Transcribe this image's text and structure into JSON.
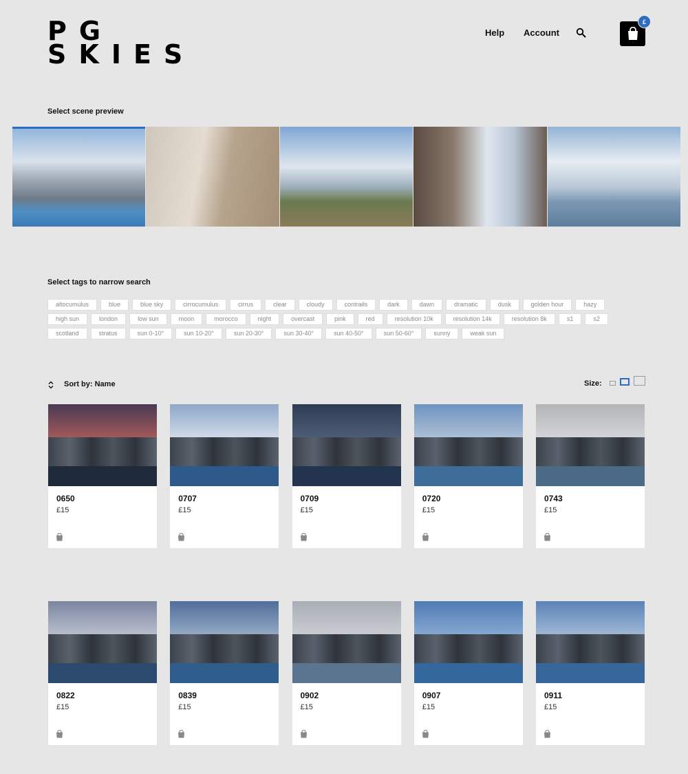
{
  "header": {
    "logo_line1": "PG",
    "logo_line2": "SKIES",
    "nav_help": "Help",
    "nav_account": "Account",
    "cart_badge": "£"
  },
  "scene_preview": {
    "label": "Select scene preview",
    "scenes": [
      "pool house",
      "interior room",
      "forest road",
      "city street",
      "ocean island"
    ]
  },
  "tags_section": {
    "label": "Select tags to narrow search",
    "tags": [
      "altocumulus",
      "blue",
      "blue sky",
      "cirrocumulus",
      "cirrus",
      "clear",
      "cloudy",
      "contrails",
      "dark",
      "dawn",
      "dramatic",
      "dusk",
      "golden hour",
      "hazy",
      "high sun",
      "london",
      "low sun",
      "moon",
      "morocco",
      "night",
      "overcast",
      "pink",
      "red",
      "resolution 10k",
      "resolution 14k",
      "resolution 8k",
      "s1",
      "s2",
      "scotland",
      "stratus",
      "sun 0-10°",
      "sun 10-20°",
      "sun 20-30°",
      "sun 30-40°",
      "sun 40-50°",
      "sun 50-60°",
      "sunny",
      "weak sun"
    ]
  },
  "sort": {
    "label": "Sort by: Name"
  },
  "size": {
    "label": "Size:"
  },
  "products": [
    {
      "id": "0650",
      "price": "£15",
      "sky": "#4a3a55",
      "sky2": "#b0605a",
      "pool": "#1f2a3a"
    },
    {
      "id": "0707",
      "price": "£15",
      "sky": "#8ea8c8",
      "sky2": "#dbe3ee",
      "pool": "#2d5a8a"
    },
    {
      "id": "0709",
      "price": "£15",
      "sky": "#2e3c55",
      "sky2": "#54637c",
      "pool": "#23354e"
    },
    {
      "id": "0720",
      "price": "£15",
      "sky": "#6f93c0",
      "sky2": "#b7c7da",
      "pool": "#3f6d99"
    },
    {
      "id": "0743",
      "price": "£15",
      "sky": "#b2b4b8",
      "sky2": "#d9dadc",
      "pool": "#4b6a86"
    },
    {
      "id": "0822",
      "price": "£15",
      "sky": "#7b86a0",
      "sky2": "#c3c7d3",
      "pool": "#2c4a6e"
    },
    {
      "id": "0839",
      "price": "£15",
      "sky": "#4f6e9a",
      "sky2": "#9fb3cb",
      "pool": "#2f5d8c"
    },
    {
      "id": "0902",
      "price": "£15",
      "sky": "#a9adb6",
      "sky2": "#cfd1d6",
      "pool": "#5b7590"
    },
    {
      "id": "0907",
      "price": "£15",
      "sky": "#4f7bb4",
      "sky2": "#8fb0d5",
      "pool": "#34679b"
    },
    {
      "id": "0911",
      "price": "£15",
      "sky": "#5b83b8",
      "sky2": "#a9bfd9",
      "pool": "#37679a"
    }
  ],
  "colors": {
    "accent": "#2d6cc0",
    "background": "#e6e6e6",
    "card": "#ffffff"
  },
  "icons": {
    "search": "search-icon",
    "cart": "shopping-bag-icon",
    "sort": "sort-arrows-icon",
    "product_bag": "bag-icon"
  }
}
